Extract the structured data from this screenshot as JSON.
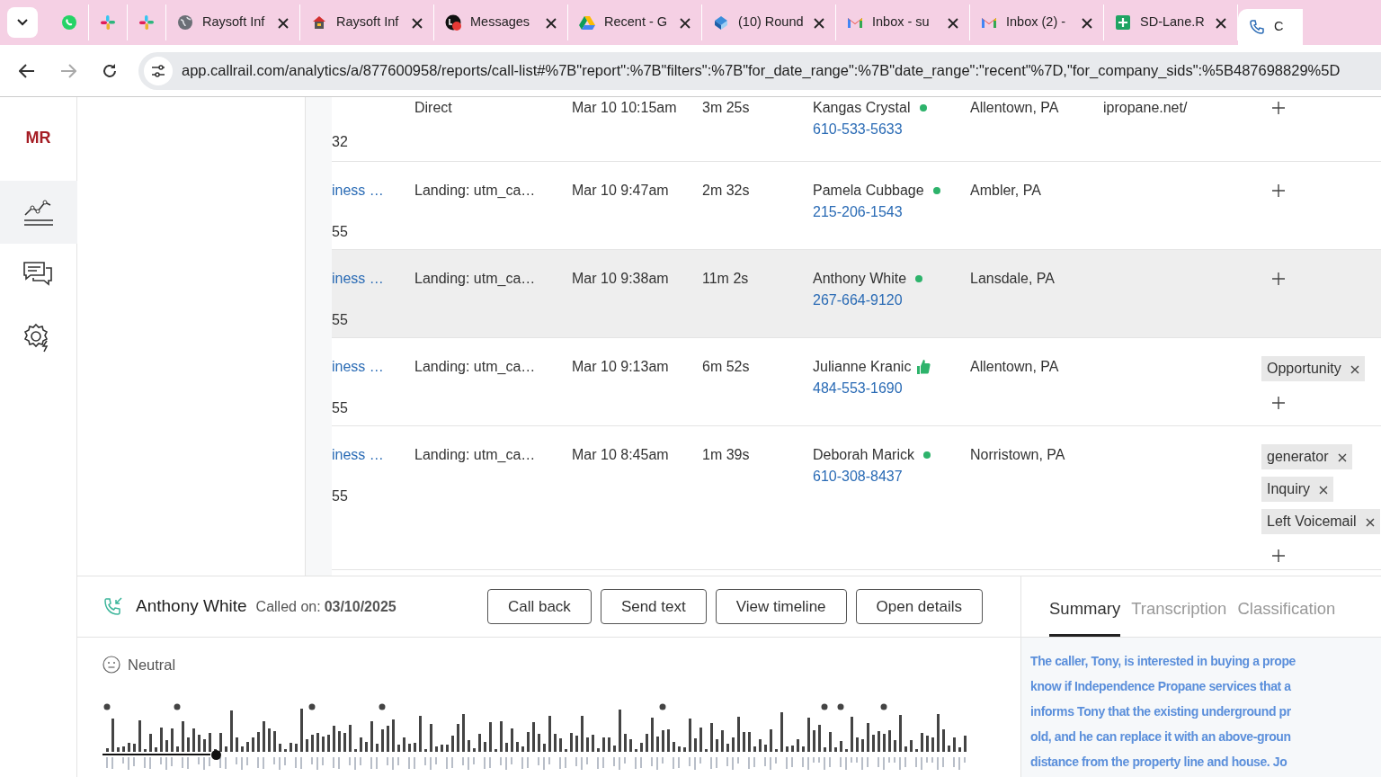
{
  "browser": {
    "tabs": [
      {
        "kind": "whatsapp",
        "selected": false
      },
      {
        "kind": "slack",
        "selected": false
      },
      {
        "kind": "slack",
        "selected": false
      },
      {
        "kind": "globe",
        "title": "Raysoft Inf",
        "selected": false
      },
      {
        "kind": "raysoft",
        "title": "Raysoft Inf",
        "selected": false
      },
      {
        "kind": "messages",
        "title": "Messages",
        "selected": false
      },
      {
        "kind": "drive",
        "title": "Recent - G",
        "selected": false
      },
      {
        "kind": "round",
        "title": "(10) Round",
        "selected": false
      },
      {
        "kind": "gmail",
        "title": "Inbox - su",
        "selected": false
      },
      {
        "kind": "gmail",
        "title": "Inbox (2) -",
        "selected": false
      },
      {
        "kind": "sheets",
        "title": "SD-Lane.R",
        "selected": false
      },
      {
        "kind": "phone",
        "title": "C",
        "selected": true
      }
    ],
    "url": "app.callrail.com/analytics/a/877600958/reports/call-list#%7B\"report\":%7B\"filters\":%7B\"for_date_range\":%7B\"date_range\":\"recent\"%7D,\"for_company_sids\":%5B487698829%5D"
  },
  "sidebar": {
    "avatar": "MR",
    "items": [
      {
        "kind": "analytics",
        "selected": true
      },
      {
        "kind": "chat",
        "selected": false
      },
      {
        "kind": "settings",
        "selected": false
      }
    ]
  },
  "table": {
    "rows": [
      {
        "source_number": "32",
        "source": "Direct",
        "time": "Mar 10 10:15am",
        "duration": "3m 25s",
        "caller": "Kangas Crystal",
        "status": {
          "kind": "dot"
        },
        "phone": "610-533-5633",
        "location": "Allentown, PA",
        "page": "ipropane.net/",
        "tags": [],
        "selected": false
      },
      {
        "source_link": "iness …",
        "source_number": "55",
        "source": "Landing: utm_ca…",
        "time": "Mar 10 9:47am",
        "duration": "2m 32s",
        "caller": "Pamela Cubbage",
        "status": {
          "kind": "dot"
        },
        "phone": "215-206-1543",
        "location": "Ambler, PA",
        "tags": [],
        "selected": false
      },
      {
        "source_link": "iness …",
        "source_number": "55",
        "source": "Landing: utm_ca…",
        "time": "Mar 10 9:38am",
        "duration": "11m 2s",
        "caller": "Anthony White",
        "status": {
          "kind": "dot"
        },
        "phone": "267-664-9120",
        "location": "Lansdale, PA",
        "tags": [],
        "selected": true
      },
      {
        "source_link": "iness …",
        "source_number": "55",
        "source": "Landing: utm_ca…",
        "time": "Mar 10 9:13am",
        "duration": "6m 52s",
        "caller": "Julianne Kranic",
        "status": {
          "kind": "thumb"
        },
        "phone": "484-553-1690",
        "location": "Allentown, PA",
        "tags": [
          "Opportunity"
        ],
        "selected": false
      },
      {
        "source_link": "iness …",
        "source_number": "55",
        "source": "Landing: utm_ca…",
        "time": "Mar 10 8:45am",
        "duration": "1m 39s",
        "caller": "Deborah Marick",
        "status": {
          "kind": "dot"
        },
        "phone": "610-308-8437",
        "location": "Norristown, PA",
        "tags": [
          "generator",
          "Inquiry",
          "Left Voicemail"
        ],
        "selected": false
      }
    ]
  },
  "detail": {
    "caller": "Anthony White",
    "called_on_label": "Called on:",
    "called_on": "03/10/2025",
    "buttons": [
      "Call back",
      "Send text",
      "View timeline",
      "Open details"
    ],
    "sentiment": "Neutral",
    "playback": {
      "level": 0.13
    },
    "tabs": [
      {
        "label": "Summary",
        "selected": true
      },
      {
        "label": "Transcription",
        "selected": false
      },
      {
        "label": "Classification",
        "selected": false
      }
    ],
    "summary_lines": [
      "The caller, Tony, is interested in buying a prope",
      "know if Independence Propane services that a",
      "informs Tony that the existing underground pr",
      "old, and he can replace it with an above-groun",
      "distance from the property line and house. Jo"
    ]
  }
}
